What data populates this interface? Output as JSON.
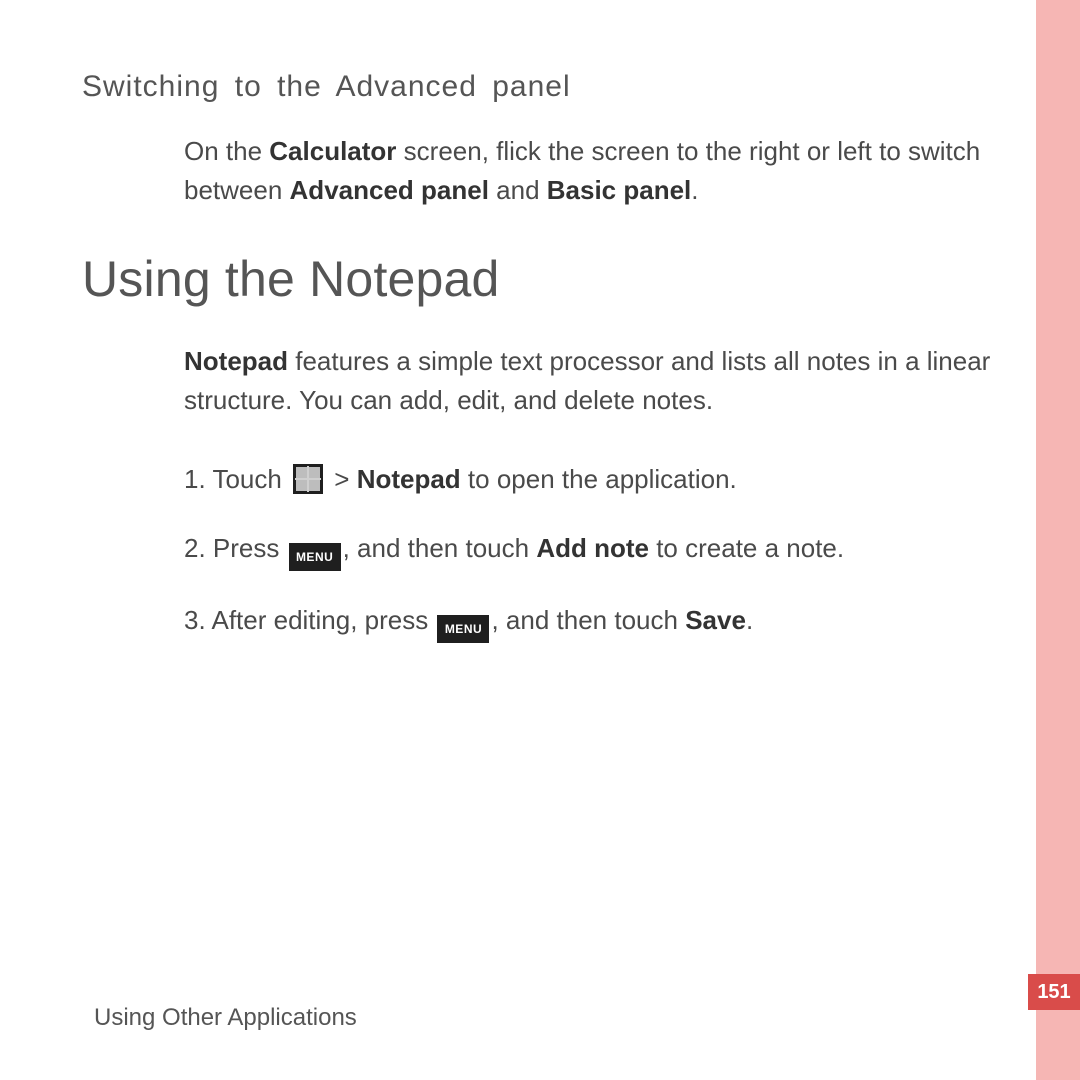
{
  "section1": {
    "heading": "Switching to the Advanced panel",
    "body": {
      "pre": "On the ",
      "b1": "Calculator",
      "mid": " screen, flick the screen to the right or left to switch between ",
      "b2": "Advanced panel",
      "mid2": " and ",
      "b3": "Basic panel",
      "post": "."
    }
  },
  "section2": {
    "heading": "Using the Notepad",
    "intro": {
      "b1": "Notepad",
      "rest": " features a simple text processor and lists all notes in a linear structure. You can add, edit, and delete notes."
    },
    "steps": {
      "s1": {
        "num": "1. ",
        "a": "Touch ",
        "gt": " > ",
        "b": "Notepad",
        "c": " to open the application."
      },
      "s2": {
        "num": "2. ",
        "a": "Press ",
        "b": ", and then touch ",
        "bold": "Add note",
        "c": " to create a note."
      },
      "s3": {
        "num": "3. ",
        "a": "After editing, press ",
        "b": ", and then touch ",
        "bold": "Save",
        "c": "."
      }
    }
  },
  "icons": {
    "menu_label": "MENU"
  },
  "footer": "Using Other Applications",
  "page_number": "151"
}
